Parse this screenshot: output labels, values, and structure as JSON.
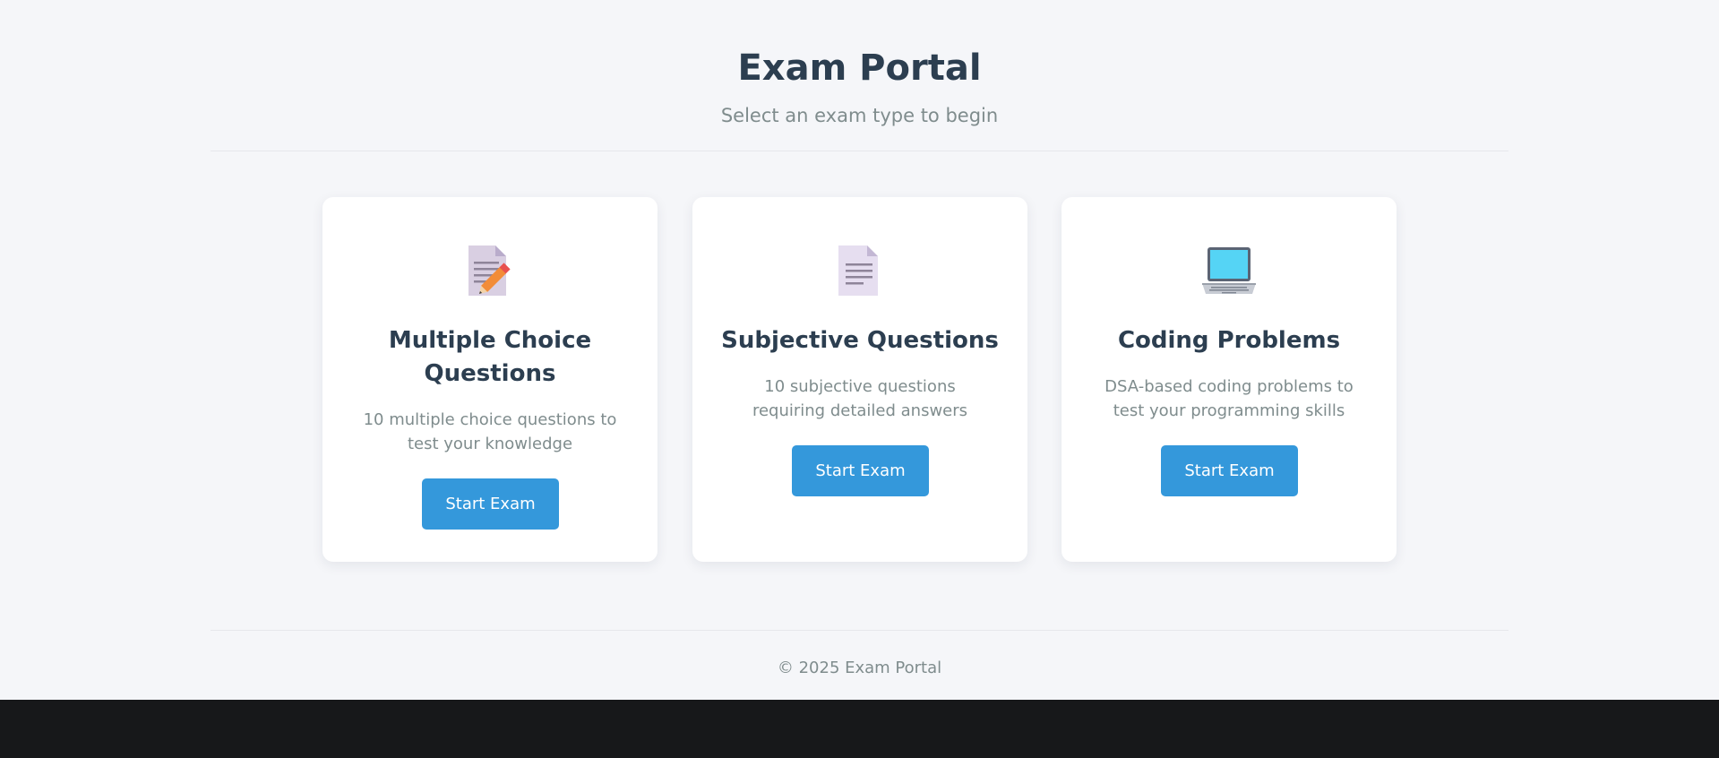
{
  "header": {
    "title": "Exam Portal",
    "subtitle": "Select an exam type to begin"
  },
  "cards": [
    {
      "icon": "document-pencil-icon",
      "title": "Multiple Choice Questions",
      "description": "10 multiple choice questions to test your knowledge",
      "button_label": "Start Exam"
    },
    {
      "icon": "document-icon",
      "title": "Subjective Questions",
      "description": "10 subjective questions requiring detailed answers",
      "button_label": "Start Exam"
    },
    {
      "icon": "laptop-icon",
      "title": "Coding Problems",
      "description": "DSA-based coding problems to test your programming skills",
      "button_label": "Start Exam"
    }
  ],
  "footer": {
    "text": "© 2025 Exam Portal"
  },
  "colors": {
    "primary": "#3498db",
    "heading": "#2c3e50",
    "muted": "#7f8c8d",
    "background": "#f5f6f9"
  }
}
